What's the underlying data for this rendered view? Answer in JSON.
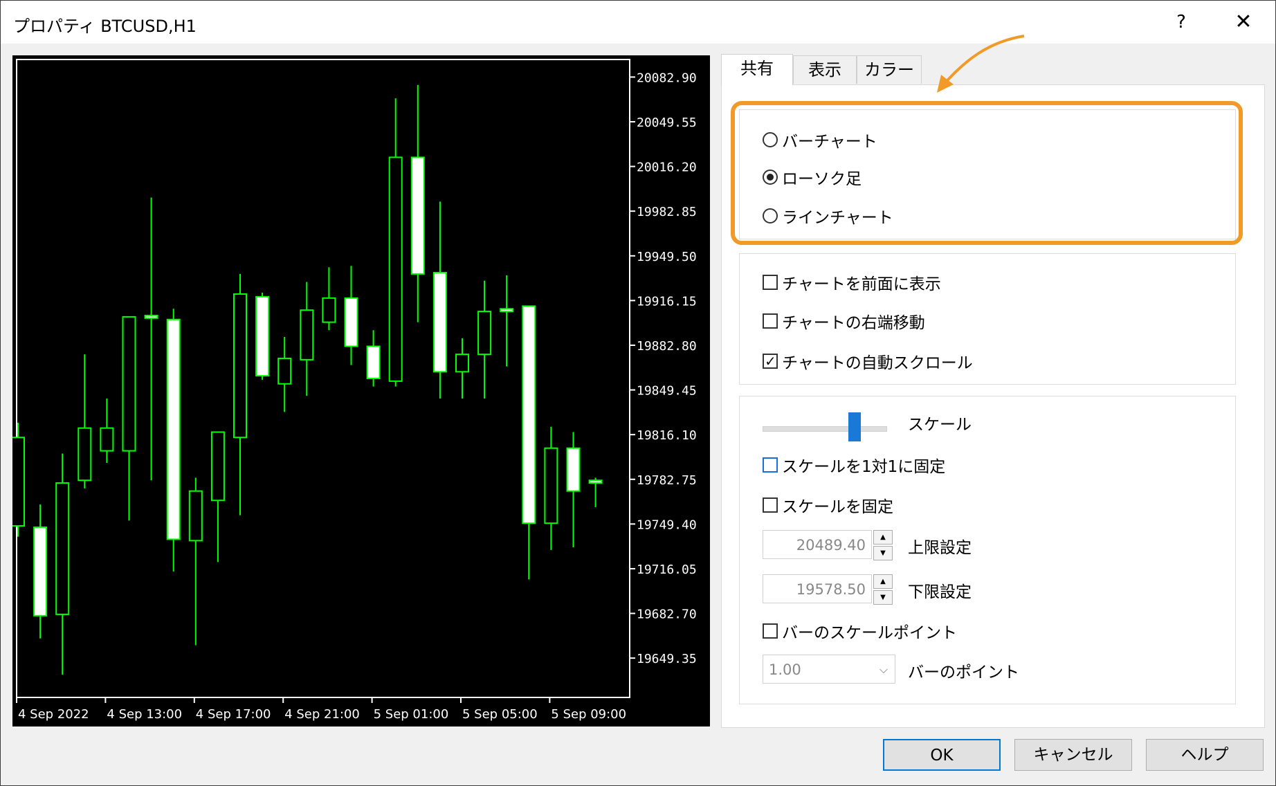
{
  "window": {
    "title": "プロパティ BTCUSD,H1",
    "help": "?",
    "close": "✕"
  },
  "tabs": [
    {
      "label": "共有",
      "active": true
    },
    {
      "label": "表示",
      "active": false
    },
    {
      "label": "カラー",
      "active": false
    }
  ],
  "chart_type": {
    "options": [
      {
        "label": "バーチャート",
        "selected": false
      },
      {
        "label": "ローソク足",
        "selected": true
      },
      {
        "label": "ラインチャート",
        "selected": false
      }
    ]
  },
  "chart_options": [
    {
      "label": "チャートを前面に表示",
      "checked": false
    },
    {
      "label": "チャートの右端移動",
      "checked": false
    },
    {
      "label": "チャートの自動スクロール",
      "checked": true
    }
  ],
  "scale": {
    "label": "スケール",
    "slider_position": 0.65,
    "fix_one_to_one": {
      "label": "スケールを1対1に固定",
      "checked": false
    },
    "fix_scale": {
      "label": "スケールを固定",
      "checked": false
    },
    "upper": {
      "label": "上限設定",
      "value": "20489.40"
    },
    "lower": {
      "label": "下限設定",
      "value": "19578.50"
    },
    "bar_scale_point": {
      "label": "バーのスケールポイント",
      "checked": false
    },
    "bar_points": {
      "label": "バーのポイント",
      "value": "1.00"
    }
  },
  "buttons": {
    "ok": "OK",
    "cancel": "キャンセル",
    "help": "ヘルプ"
  },
  "colors": {
    "accent_highlight": "#f29a28",
    "candle_outline": "#00ff00",
    "candle_bull_fill": "#ffffff",
    "chart_background": "#000000",
    "axis": "#ffffff"
  },
  "chart_data": {
    "type": "candlestick",
    "y_ticks": [
      20082.9,
      20049.55,
      20016.2,
      19982.85,
      19949.5,
      19916.15,
      19882.8,
      19849.45,
      19816.1,
      19782.75,
      19749.4,
      19716.05,
      19682.7,
      19649.35
    ],
    "y_tick_labels": [
      "20082.90",
      "20049.55",
      "20016.20",
      "19982.85",
      "19949.50",
      "19916.15",
      "19882.80",
      "19849.45",
      "19816.10",
      "19782.75",
      "19749.40",
      "19716.05",
      "19682.70",
      "19649.35"
    ],
    "x_tick_labels": [
      "4 Sep 2022",
      "4 Sep 13:00",
      "4 Sep 17:00",
      "4 Sep 21:00",
      "5 Sep 01:00",
      "5 Sep 05:00",
      "5 Sep 09:00"
    ],
    "x_tick_index": [
      0,
      4,
      8,
      12,
      16,
      20,
      24
    ],
    "ylim": [
      19620,
      20096
    ],
    "candles": [
      {
        "o": 19748,
        "c": 19814,
        "h": 19825,
        "l": 19740
      },
      {
        "o": 19747,
        "c": 19681,
        "h": 19764,
        "l": 19664
      },
      {
        "o": 19682,
        "c": 19780,
        "h": 19802,
        "l": 19637
      },
      {
        "o": 19782,
        "c": 19821,
        "h": 19876,
        "l": 19776
      },
      {
        "o": 19804,
        "c": 19821,
        "h": 19843,
        "l": 19795
      },
      {
        "o": 19804,
        "c": 19904,
        "h": 19904,
        "l": 19752
      },
      {
        "o": 19905,
        "c": 19903,
        "h": 19993,
        "l": 19782
      },
      {
        "o": 19902,
        "c": 19738,
        "h": 19910,
        "l": 19714
      },
      {
        "o": 19737,
        "c": 19774,
        "h": 19784,
        "l": 19659
      },
      {
        "o": 19767,
        "c": 19818,
        "h": 19818,
        "l": 19721
      },
      {
        "o": 19814,
        "c": 19921,
        "h": 19936,
        "l": 19756
      },
      {
        "o": 19919,
        "c": 19860,
        "h": 19922,
        "l": 19857
      },
      {
        "o": 19854,
        "c": 19873,
        "h": 19889,
        "l": 19833
      },
      {
        "o": 19872,
        "c": 19909,
        "h": 19930,
        "l": 19845
      },
      {
        "o": 19900,
        "c": 19918,
        "h": 19941,
        "l": 19894
      },
      {
        "o": 19918,
        "c": 19882,
        "h": 19942,
        "l": 19868
      },
      {
        "o": 19882,
        "c": 19858,
        "h": 19894,
        "l": 19852
      },
      {
        "o": 19856,
        "c": 20023,
        "h": 20067,
        "l": 19852
      },
      {
        "o": 20023,
        "c": 19936,
        "h": 20077,
        "l": 19900
      },
      {
        "o": 19937,
        "c": 19863,
        "h": 19990,
        "l": 19843
      },
      {
        "o": 19863,
        "c": 19876,
        "h": 19888,
        "l": 19843
      },
      {
        "o": 19876,
        "c": 19908,
        "h": 19931,
        "l": 19843
      },
      {
        "o": 19910,
        "c": 19908,
        "h": 19935,
        "l": 19867
      },
      {
        "o": 19912,
        "c": 19750,
        "h": 19912,
        "l": 19708
      },
      {
        "o": 19750,
        "c": 19806,
        "h": 19822,
        "l": 19730
      },
      {
        "o": 19806,
        "c": 19774,
        "h": 19818,
        "l": 19732
      },
      {
        "o": 19782,
        "c": 19780,
        "h": 19784,
        "l": 19762
      }
    ]
  }
}
